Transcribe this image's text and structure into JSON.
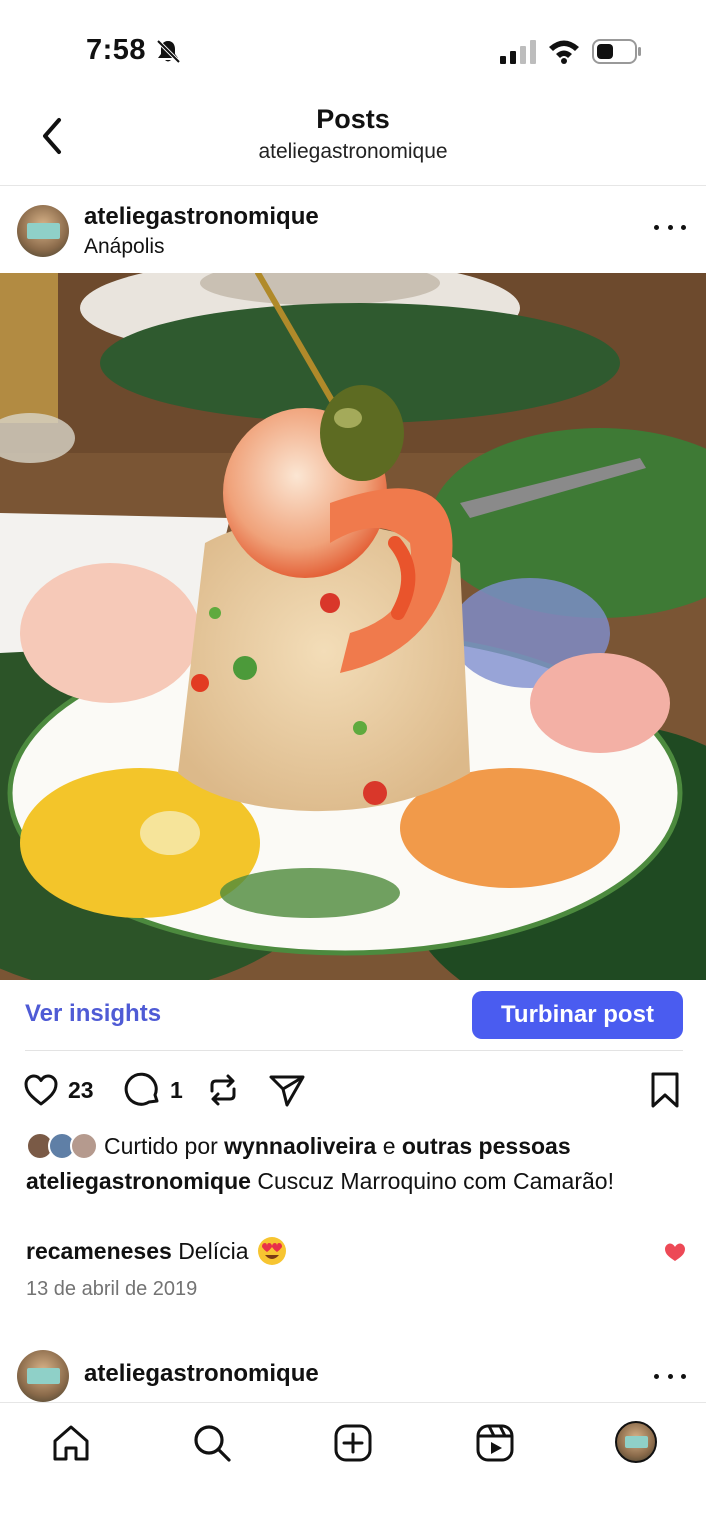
{
  "status_bar": {
    "time": "7:58"
  },
  "header": {
    "title": "Posts",
    "subtitle": "ateliegastronomique"
  },
  "post": {
    "username": "ateliegastronomique",
    "location": "Anápolis",
    "insights_label": "Ver insights",
    "boost_label": "Turbinar post",
    "like_count": "23",
    "comment_count": "1",
    "liked_by_prefix": "Curtido por",
    "liked_by_user": "wynnaoliveira",
    "liked_by_conj": "e",
    "liked_by_suffix": "outras pessoas",
    "caption_user": "ateliegastronomique",
    "caption_text": "Cuscuz Marroquino com Camarão!",
    "comment_user": "recameneses",
    "comment_text": "Delícia",
    "date": "13 de abril de 2019"
  },
  "next_post": {
    "username": "ateliegastronomique"
  },
  "icons": {
    "back": "chevron-left-icon",
    "more": "more-horizontal-icon",
    "like": "heart-icon",
    "comment": "comment-icon",
    "repost": "repost-icon",
    "share": "send-icon",
    "save": "bookmark-icon"
  },
  "colors": {
    "accent": "#4a5cf0",
    "link": "#4f5bd5",
    "heart": "#ed4956",
    "muted": "#737373"
  }
}
